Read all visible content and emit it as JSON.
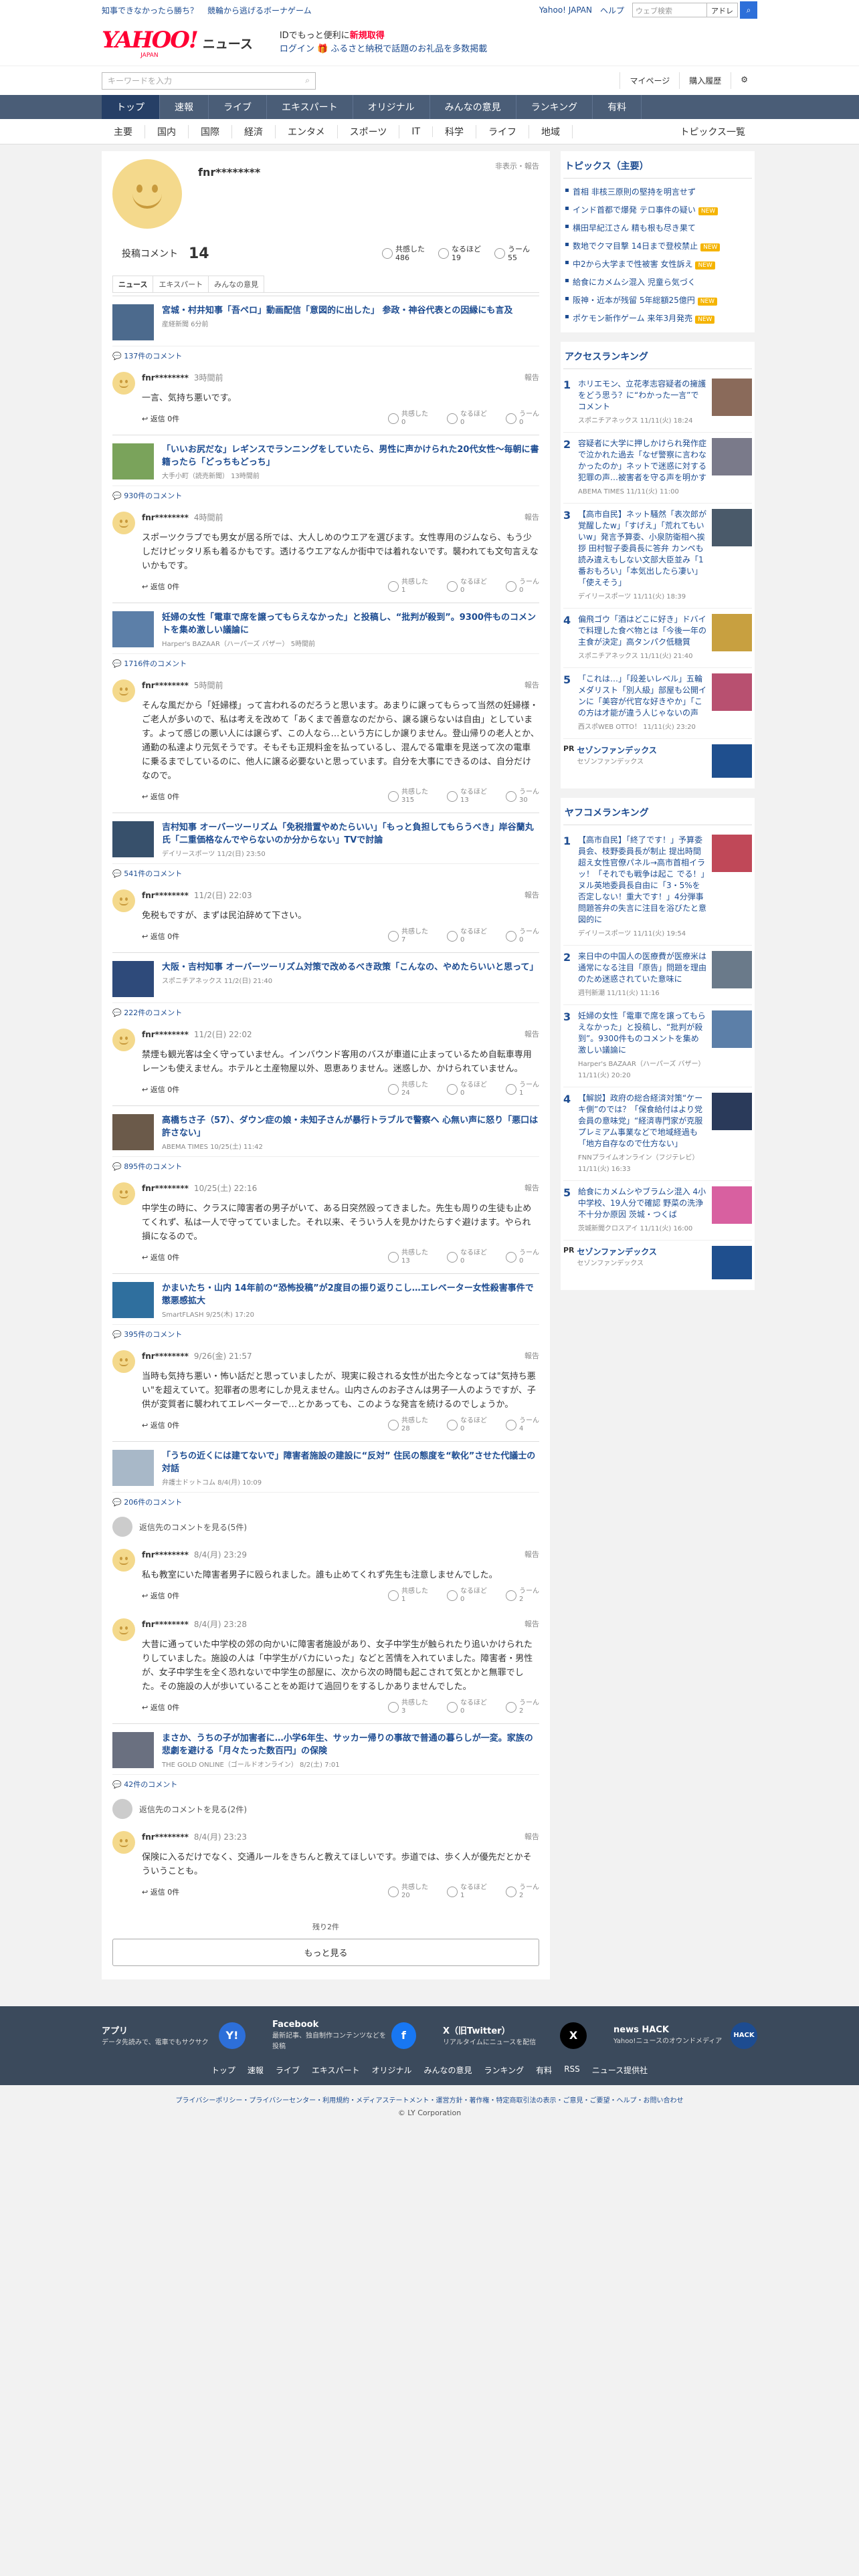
{
  "topbar": {
    "links": [
      "知事できなかったら勝ち？",
      "競輪から逃げるボーナゲーム"
    ],
    "right_links": [
      "Yahoo! JAPAN",
      "ヘルプ"
    ],
    "search_placeholder": "ウェブ検索",
    "search_btn": "アドレ"
  },
  "header": {
    "logo": "YAHOO!",
    "logo_sub": "JAPAN",
    "news": "ニュース",
    "promo1": "IDでもっと便利に",
    "promo1b": "新規取得",
    "promo2": "ログイン",
    "promo2b": "🎁 ふるさと納税で話題のお礼品を多数掲載"
  },
  "search": {
    "placeholder": "キーワードを入力",
    "mypage": "マイページ",
    "history": "購入履歴"
  },
  "nav": [
    "トップ",
    "速報",
    "ライブ",
    "エキスパート",
    "オリジナル",
    "みんなの意見",
    "ランキング",
    "有料"
  ],
  "subnav": [
    "主要",
    "国内",
    "国際",
    "経済",
    "エンタメ",
    "スポーツ",
    "IT",
    "科学",
    "ライフ",
    "地域"
  ],
  "subnav_right": "トピックス一覧",
  "profile": {
    "name": "fnr********",
    "hide": "非表示・報告",
    "label": "投稿コメント",
    "count": "14",
    "reactions": [
      {
        "label": "共感した",
        "v": "486"
      },
      {
        "label": "なるほど",
        "v": "19"
      },
      {
        "label": "うーん",
        "v": "55"
      }
    ]
  },
  "tabs": [
    "ニュース",
    "エキスパート",
    "みんなの意見"
  ],
  "articles": [
    {
      "title": "宮城・村井知事「吾ペロ」動画配信「意図的に出した」 参政・神谷代表との因縁にも言及",
      "src": "産経新聞 6分前",
      "thumb": "#4c6a8d",
      "count": "137件のコメント",
      "comments": [
        {
          "user": "fnr********",
          "date": "3時間前",
          "text": "一言、気持ち悪いです。",
          "r": [
            "0",
            "0",
            "0"
          ]
        }
      ]
    },
    {
      "title": "「いいお尻だな」レギンスでランニングをしていたら、男性に声かけられた20代女性～毎朝に書籍ったら「どっちもどっち」",
      "src": "大手小町（読売新聞） 13時間前",
      "thumb": "#7aa35b",
      "count": "930件のコメント",
      "comments": [
        {
          "user": "fnr********",
          "date": "4時間前",
          "text": "スポーツクラブでも男女が居る所では、大人しめのウエアを選びます。女性専用のジムなら、もう少しだけピッタリ系も着るかもです。透けるウエアなんか街中では着れないです。襲われても文句言えないかもです。",
          "r": [
            "1",
            "0",
            "0"
          ]
        }
      ]
    },
    {
      "title": "妊婦の女性「電車で席を譲ってもらえなかった」と投稿し、“批判が殺到”。9300件ものコメントを集め激しい議論に",
      "src": "Harper's BAZAAR（ハーパーズ バザー） 5時間前",
      "thumb": "#5c7fa8",
      "count": "1716件のコメント",
      "comments": [
        {
          "user": "fnr********",
          "date": "5時間前",
          "text": "そんな風だから「妊婦様」って言われるのだろうと思います。あまりに譲ってもらって当然の妊婦様・ご老人が多いので、私は考えを改めて「あくまで善意なのだから、譲る譲らないは自由」としています。よって感じの悪い人には譲らず、この人なら…という方にしか譲りません。登山帰りの老人とか、通勤の私達より元気そうです。そもそも正規料金を払っているし、混んでる電車を見送って次の電車に乗るまでしているのに、他人に譲る必要ないと思っています。自分を大事にできるのは、自分だけなので。",
          "r": [
            "315",
            "13",
            "30"
          ]
        }
      ]
    },
    {
      "title": "吉村知事 オーバーツーリズム「免税措置やめたらいい」「もっと負担してもらうべき」岸谷蘭丸氏「二重価格なんでやらないのか分からない」TVで討論",
      "src": "デイリースポーツ 11/2(日) 23:50",
      "thumb": "#37506b",
      "count": "541件のコメント",
      "comments": [
        {
          "user": "fnr********",
          "date": "11/2(日) 22:03",
          "text": "免税もですが、まずは民泊辞めて下さい。",
          "r": [
            "7",
            "0",
            "0"
          ]
        }
      ]
    },
    {
      "title": "大阪・吉村知事 オーバーツーリズム対策で改めるべき政策「こんなの、やめたらいいと思って」",
      "src": "スポニチアネックス 11/2(日) 21:40",
      "thumb": "#2e4a7a",
      "count": "222件のコメント",
      "comments": [
        {
          "user": "fnr********",
          "date": "11/2(日) 22:02",
          "text": "禁煙も観光客は全く守っていません。インバウンド客用のバスが車道に止まっているため自転車専用レーンも使えません。ホテルと土産物屋以外、恩恵ありません。迷惑しか、かけられていません。",
          "r": [
            "24",
            "0",
            "1"
          ]
        }
      ]
    },
    {
      "title": "高橋ちさ子（57）、ダウン症の娘・未知子さんが暴行トラブルで警察へ 心無い声に怒り「悪口は許さない」",
      "src": "ABEMA TIMES 10/25(土) 11:42",
      "thumb": "#6b5a4a",
      "count": "895件のコメント",
      "comments": [
        {
          "user": "fnr********",
          "date": "10/25(土) 22:16",
          "text": "中学生の時に、クラスに障害者の男子がいて、ある日突然殴ってきました。先生も周りの生徒も止めてくれず、私は一人で守ってていました。それ以来、そういう人を見かけたらすぐ避けます。やられ損になるので。",
          "r": [
            "13",
            "0",
            "0"
          ]
        }
      ]
    },
    {
      "title": "かまいたち・山内 14年前の“恐怖投稿”が2度目の振り返りこし…エレベーター女性殺害事件で懲悪感拡大",
      "src": "SmartFLASH 9/25(木) 17:20",
      "thumb": "#2f6f9e",
      "count": "395件のコメント",
      "comments": [
        {
          "user": "fnr********",
          "date": "9/26(金) 21:57",
          "text": "当時も気持ち悪い・怖い話だと思っていましたが、現実に殺される女性が出た今となっては\"気持ち悪い\"を超えていて。犯罪者の思考にしか見えません。山内さんのお子さんは男子一人のようですが、子供が変質者に襲われてエレベーターで…とかあっても、このような発言を続けるのでしょうか。",
          "r": [
            "28",
            "0",
            "4"
          ]
        }
      ]
    },
    {
      "title": "「うちの近くには建てないで」障害者施設の建設に“反対” 住民の態度を“軟化”させた代議士の対話",
      "src": "弁護士ドットコム 8/4(月) 10:09",
      "thumb": "#a8b8c8",
      "count": "206件のコメント",
      "deleted": "返信先のコメントを見る(5件)",
      "comments": [
        {
          "user": "fnr********",
          "date": "8/4(月) 23:29",
          "text": "私も教室にいた障害者男子に殴られました。誰も止めてくれず先生も注意しませんでした。",
          "r": [
            "1",
            "0",
            "2"
          ]
        },
        {
          "user": "fnr********",
          "date": "8/4(月) 23:28",
          "text": "大昔に通っていた中学校の郊の向かいに障害者施設があり、女子中学生が触られたり追いかけられたりしていました。施設の人は「中学生がバカにいった」などと苦情を入れていました。障害者・男性が、女子中学生を全く恐れないで中学生の部屋に、次から次の時間も起こされて気とかと無罪でした。その施設の人が歩いていることをめ距けて過回りをするしかありませんでした。",
          "r": [
            "3",
            "0",
            "2"
          ]
        }
      ]
    },
    {
      "title": "まさか、うちの子が加害者に…小学6年生、サッカー帰りの事故で普通の暮らしが一変。家族の悲劇を避ける「月々たった数百円」の保険",
      "src": "THE GOLD ONLINE（ゴールドオンライン） 8/2(土) 7:01",
      "thumb": "#6a7080",
      "count": "42件のコメント",
      "deleted": "返信先のコメントを見る(2件)",
      "comments": [
        {
          "user": "fnr********",
          "date": "8/4(月) 23:23",
          "text": "保険に入るだけでなく、交通ルールをきちんと教えてほしいです。歩道では、歩く人が優先だとかそういうことも。",
          "r": [
            "20",
            "1",
            "2"
          ]
        }
      ]
    }
  ],
  "more": {
    "remaining": "残り2件",
    "button": "もっと見る"
  },
  "reply_label": "返信 0件",
  "report": "報告",
  "react_labels": [
    "共感した",
    "なるほど",
    "うーん"
  ],
  "side": {
    "topics_title": "トピックス（主要）",
    "topics": [
      {
        "t": "首相 非核三原則の堅持を明言せず",
        "n": ""
      },
      {
        "t": "インド首都で爆発 テロ事件の疑い",
        "n": "NEW"
      },
      {
        "t": "横田早紀江さん 精も根も尽き果て",
        "n": ""
      },
      {
        "t": "数地でクマ目撃 14日まで登校禁止",
        "n": "NEW"
      },
      {
        "t": "中2から大学まで性被害 女性訴え",
        "n": "NEW"
      },
      {
        "t": "給食にカメムシ混入 児童ら気づく",
        "n": ""
      },
      {
        "t": "阪神・近本が残留 5年総額25億円",
        "n": "NEW"
      },
      {
        "t": "ポケモン新作ゲーム 来年3月発売",
        "n": "NEW"
      }
    ],
    "access_title": "アクセスランキング",
    "access": [
      {
        "t": "ホリエモン、立花孝志容疑者の擁護をどう思う？に“わかった一言”でコメント",
        "s": "スポニチアネックス 11/11(火) 18:24",
        "c": "#8a6a5a"
      },
      {
        "t": "容疑者に大学に押しかけられ発作症で泣かれた過去「なぜ警察に言わなかったのか」ネットで迷惑に対する犯罪の声…被害者を守る声を明かす",
        "s": "ABEMA TIMES 11/11(火) 11:00",
        "c": "#7a7a8a"
      },
      {
        "t": "【高市自民】ネット騒然「表次郎が覚醒したw」「すげえ」「荒れてもいいw」発言予算委、小泉防衛相へ挨拶 田村智子委員長に答弁 カンペも読み違えもしない文部大臣並み「1番おもろい」「本気出したら凄い」「使えそう」",
        "s": "デイリースポーツ 11/11(火) 18:39",
        "c": "#4a5a6a"
      },
      {
        "t": "偏飛ゴウ「酒はどこに好き」ドバイで料理した食べ物とは「今後一年の主食が決定」高タンパク低糖質",
        "s": "スポニチアネックス 11/11(火) 21:40",
        "c": "#c8a040"
      },
      {
        "t": "「これは…」「段差いレベル」五輪メダリスト「別人級」部屋も公開インに「美容が代官な好きやか」「この方は才能が違う人じゃないの声",
        "s": "西スポWEB OTTO！ 11/11(火) 23:20",
        "c": "#b85070"
      }
    ],
    "pr1": {
      "tag": "PR",
      "t": "セゾンファンデックス",
      "s": "セゾンファンデックス"
    },
    "yahoo_title": "ヤフコメランキング",
    "yahoo": [
      {
        "t": "【高市自民】「終了です！」予算委員会、枝野委員長が制止 提出時間超え女性官僚パネル→高市首相イラッ！「それでも戦争は起こ でる！」ヌル英地委員長自由に「3・5%を否定しない！重大です！」4分弾事問題答弁の失言に注目を浴びたと意図的に",
        "s": "デイリースポーツ 11/11(火) 19:54",
        "c": "#c04858"
      },
      {
        "t": "来日中の中国人の医療費が医療米は通常になる注目「原告」問題を理由のため迷惑されていた意味に",
        "s": "週刊新潮 11/11(火) 11:16",
        "c": "#6a7a8a"
      },
      {
        "t": "妊婦の女性「電車で席を譲ってもらえなかった」と投稿し、“批判が殺到”。9300件ものコメントを集め激しい議論に",
        "s": "Harper's BAZAAR（ハーパーズ バザー） 11/11(火) 20:20",
        "c": "#5c7fa8"
      },
      {
        "t": "【解説】政府の総合経済対策“ケーキ側”のでは？「保食給付はより党会員の意味党」“経済専門家が克服 プレミアム事業などで地域経過も「地方自存なので仕方ない」",
        "s": "FNNプライムオンライン（フジテレビ） 11/11(火) 16:33",
        "c": "#2a3a5a"
      },
      {
        "t": "給食にカメムシやブラムシ混入 4小中学校、19人分で確認 野菜の洗浄不十分か原因 茨城・つくば",
        "s": "茨城新聞クロスアイ 11/11(火) 16:00",
        "c": "#d860a0"
      }
    ],
    "pr2": {
      "tag": "PR",
      "t": "セゾンファンデックス",
      "s": "セゾンファンデックス"
    }
  },
  "footer": {
    "apps": [
      {
        "t": "アプリ",
        "s": "データ先読みで、電車でもサクサク",
        "ic": "Y!"
      },
      {
        "t": "Facebook",
        "s": "最新記事、独自制作コンテンツなどを投稿",
        "ic": "f"
      },
      {
        "t": "X（旧Twitter）",
        "s": "リアルタイムにニュースを配信",
        "ic": "X"
      },
      {
        "t": "news HACK",
        "s": "Yahoo!ニュースのオウンドメディア",
        "ic": "HACK"
      }
    ],
    "nav": [
      "トップ",
      "速報",
      "ライブ",
      "エキスパート",
      "オリジナル",
      "みんなの意見",
      "ランキング",
      "有料",
      "RSS",
      "ニュース提供社"
    ],
    "links": "プライバシーポリシー・プライバシーセンター・利用規約・メディアステートメント・運営方針・著作権・特定商取引法の表示・ご意見・ご要望・ヘルプ・お問い合わせ",
    "copy": "© LY Corporation"
  }
}
